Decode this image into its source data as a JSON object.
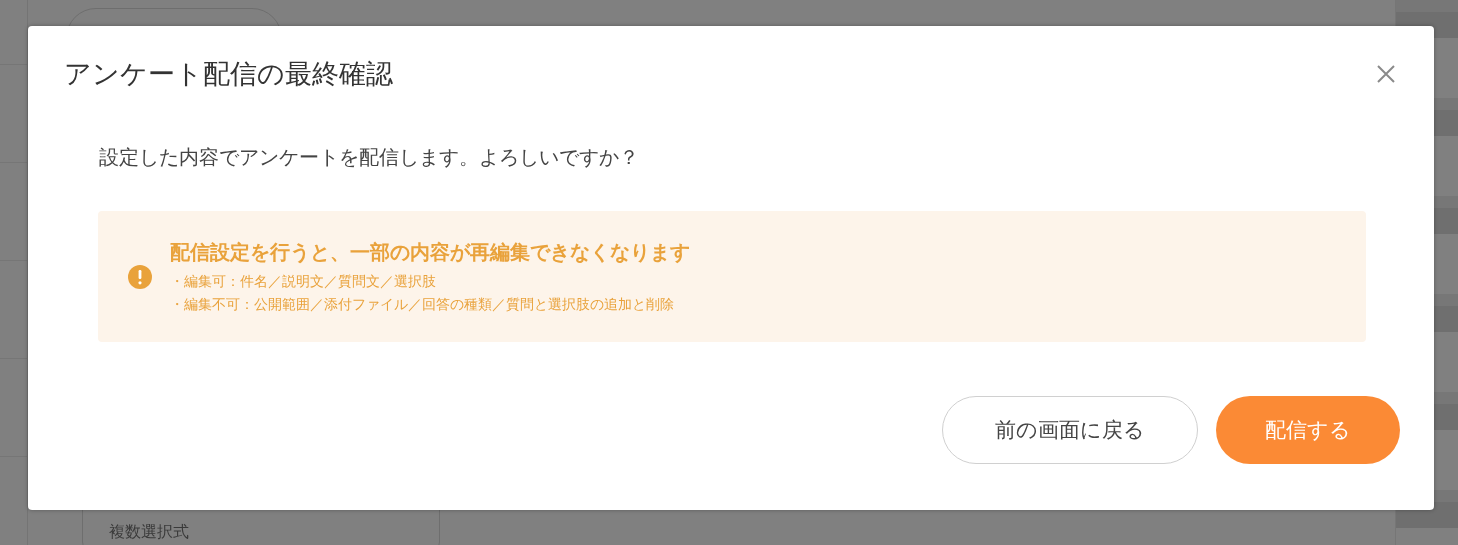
{
  "background": {
    "dropdown": {
      "value": "複数選択式"
    }
  },
  "dialog": {
    "title": "アンケート配信の最終確認",
    "message": "設定した内容でアンケートを配信します。よろしいですか？",
    "warning": {
      "heading": "配信設定を行うと、一部の内容が再編集できなくなります",
      "items": [
        "・編集可：件名／説明文／質問文／選択肢",
        "・編集不可：公開範囲／添付ファイル／回答の種類／質問と選択肢の追加と削除"
      ]
    },
    "buttons": [
      {
        "label": "前の画面に戻る",
        "kind": "secondary"
      },
      {
        "label": "配信する",
        "kind": "primary"
      }
    ]
  }
}
